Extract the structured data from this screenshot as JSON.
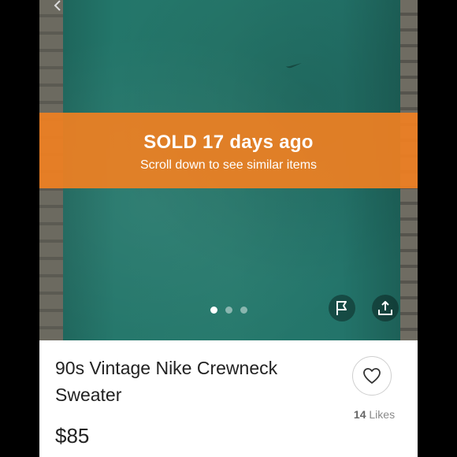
{
  "banner": {
    "status": "SOLD 17 days ago",
    "subtitle": "Scroll down to see similar items",
    "color": "#F08022"
  },
  "carousel": {
    "total_images": 3,
    "active_index": 0
  },
  "actions": {
    "flag_icon": "flag-icon",
    "share_icon": "share-icon",
    "like_icon": "heart-icon",
    "back_icon": "chevron-left-icon"
  },
  "listing": {
    "title": "90s Vintage Nike Crewneck Sweater",
    "price": "$85",
    "likes_count": "14",
    "likes_label": "Likes"
  }
}
